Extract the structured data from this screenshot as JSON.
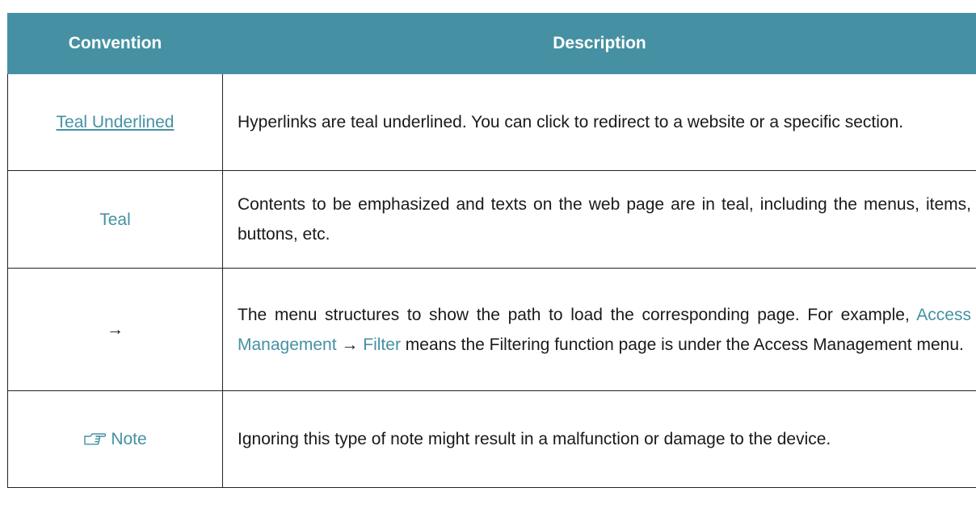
{
  "table": {
    "headers": {
      "convention": "Convention",
      "description": "Description"
    },
    "rows": [
      {
        "convention": "Teal Underlined",
        "description": "Hyperlinks are teal underlined. You can click to redirect to a website or a specific section."
      },
      {
        "convention": "Teal",
        "description": "Contents to be emphasized and texts on the web page are in teal, including the menus, items, buttons, etc."
      },
      {
        "convention": "→",
        "description_parts": {
          "line1": "The menu structures to show the path to load the corresponding page.",
          "for_example": "For example,",
          "menu": "Access Management",
          "arrow": "→",
          "item": "Filter",
          "rest": "means the Filtering function page is under the Access Management menu."
        }
      },
      {
        "convention": "Note",
        "icon": "pointing-hand-icon",
        "description": "Ignoring this type of note might result in a malfunction or damage to the device."
      }
    ]
  },
  "colors": {
    "header_bg": "#4591a3",
    "teal": "#4591a3",
    "border": "#222222"
  }
}
